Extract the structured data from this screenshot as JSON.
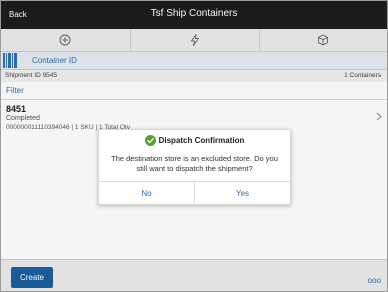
{
  "header": {
    "back_label": "Back",
    "title": "Tsf Ship Containers"
  },
  "toolbar": {
    "icons": [
      "plus-circle-icon",
      "lightning-icon",
      "box-icon"
    ]
  },
  "scan": {
    "label": "Container ID"
  },
  "info": {
    "shipment": "Shipment ID 9545",
    "count": "1 Containers"
  },
  "filter_label": "Filter",
  "record": {
    "number": "8451",
    "status": "Completed",
    "detail": "000000011110394046 | 1 SKU | 1 Total Qty"
  },
  "dialog": {
    "title": "Dispatch Confirmation",
    "message": "The destination store is an excluded store. Do you still want to dispatch the shipment?",
    "no_label": "No",
    "yes_label": "Yes"
  },
  "footer": {
    "create_label": "Create",
    "more_label": "ooo"
  },
  "colors": {
    "accent": "#2f6fb5",
    "primary_button": "#1a5fa0",
    "header": "#1e1e1e",
    "success": "#5aa02c"
  }
}
